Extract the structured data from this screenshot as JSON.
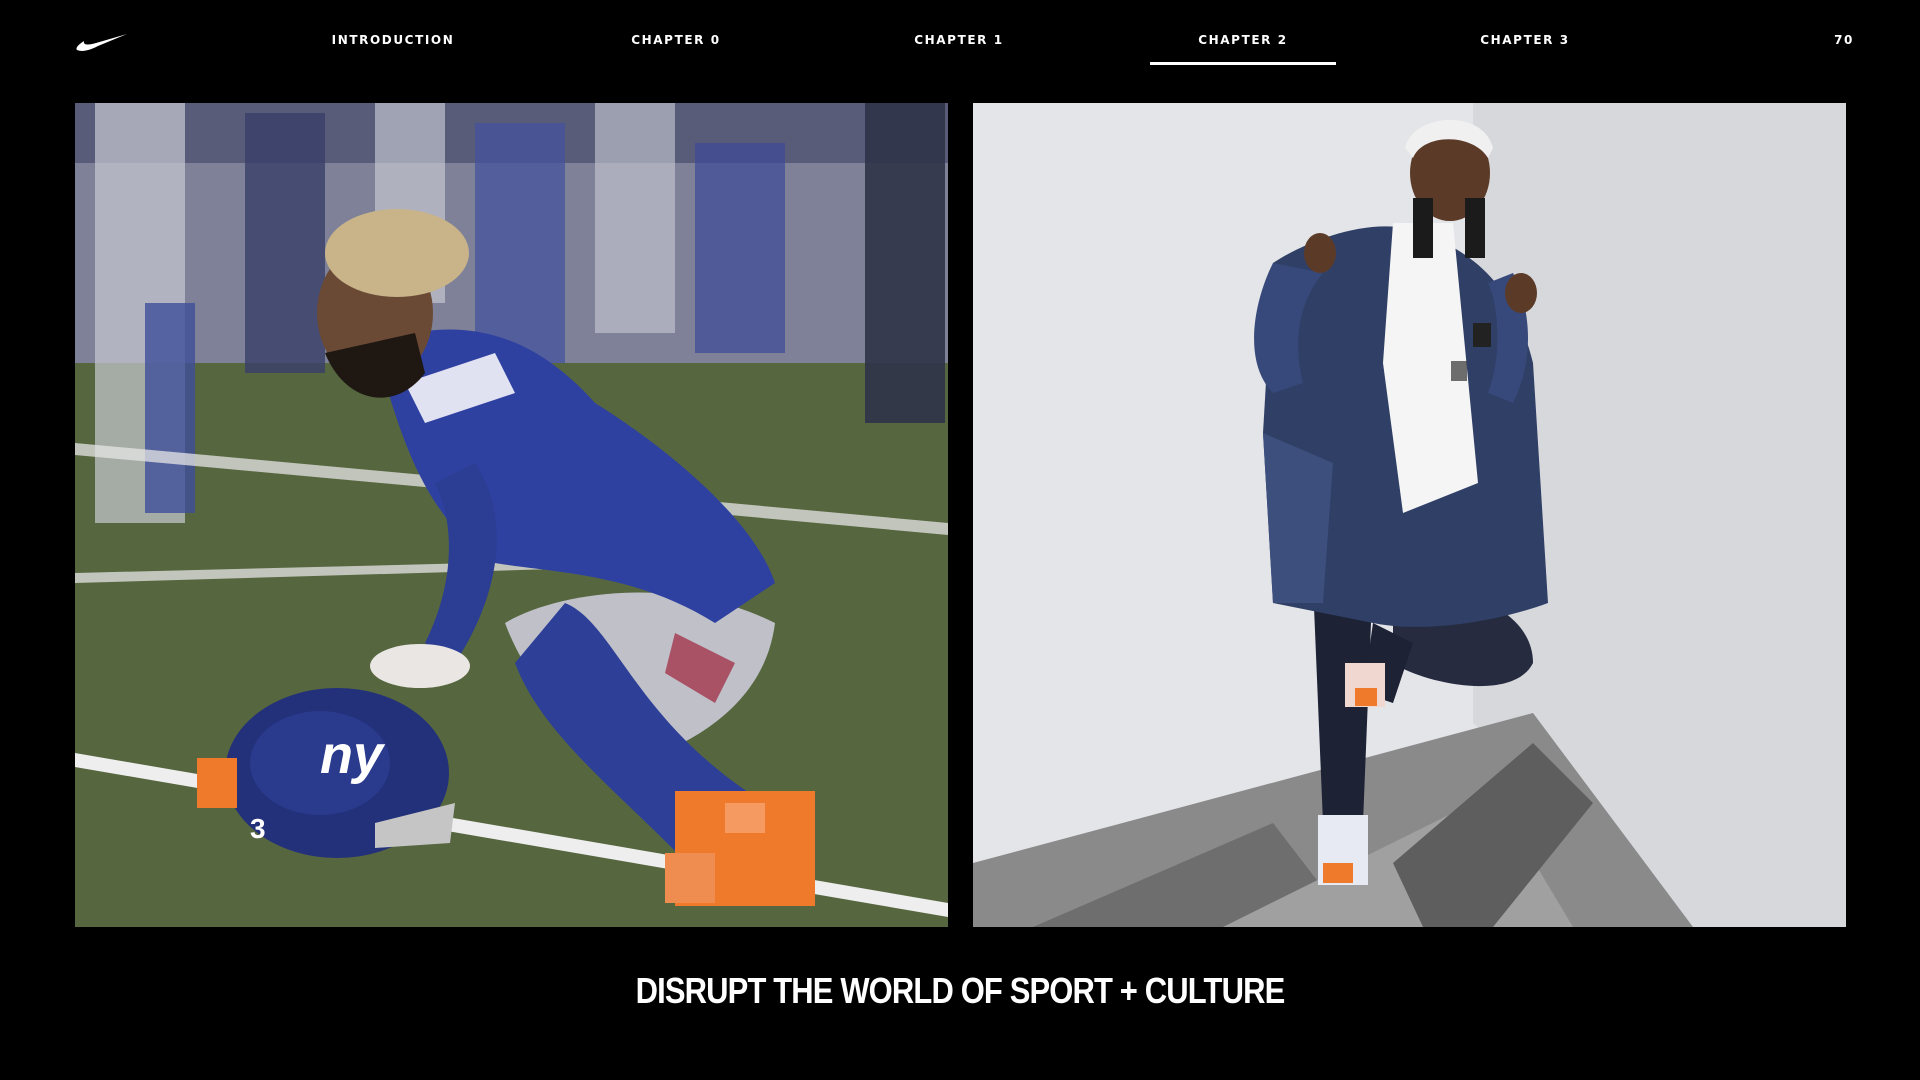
{
  "brand": {
    "logo_icon": "swoosh-icon"
  },
  "nav": {
    "items": [
      {
        "label": "INTRODUCTION",
        "active": false
      },
      {
        "label": "CHAPTER 0",
        "active": false
      },
      {
        "label": "CHAPTER 1",
        "active": false
      },
      {
        "label": "CHAPTER 2",
        "active": true
      },
      {
        "label": "CHAPTER 3",
        "active": false
      }
    ],
    "page_number": "70"
  },
  "photos": {
    "left": {
      "helmet_logo": "ny",
      "helmet_number": "3"
    }
  },
  "headline": "DISRUPT THE WORLD OF SPORT + CULTURE",
  "colors": {
    "background": "#000000",
    "text": "#ffffff",
    "accent_orange": "#f07a2c",
    "giants_blue": "#2a3a8c"
  }
}
